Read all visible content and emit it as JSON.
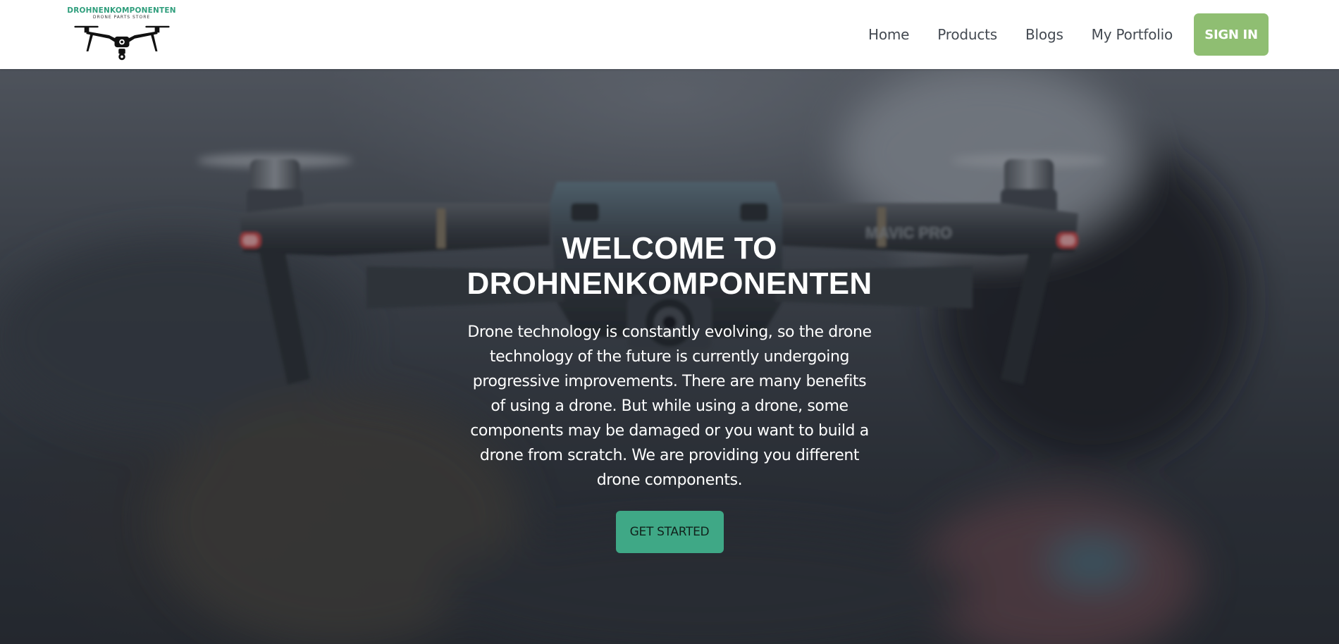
{
  "brand": {
    "name": "DROHNENKOMPONENTEN",
    "tagline": "DRONE PARTS STORE"
  },
  "nav": {
    "links": [
      "Home",
      "Products",
      "Blogs",
      "My Portfolio"
    ],
    "signin_label": "SIGN IN"
  },
  "hero": {
    "title_line1": "WELCOME TO",
    "title_line2": "DROHNENKOMPONENTEN",
    "description": "Drone technology is constantly evolving, so the drone technology of the future is currently undergoing progressive improvements. There are many benefits of using a drone. But while using a drone, some components may be damaged or you want to build a drone from scratch. We are providing you different drone components.",
    "cta_label": "GET STARTED",
    "drone_marking": "MAVIC PRO"
  },
  "colors": {
    "brand_green": "#2f9e7c",
    "signin_bg": "#8fbe72",
    "cta_bg": "#3fa886",
    "nav_text": "#444a52"
  }
}
